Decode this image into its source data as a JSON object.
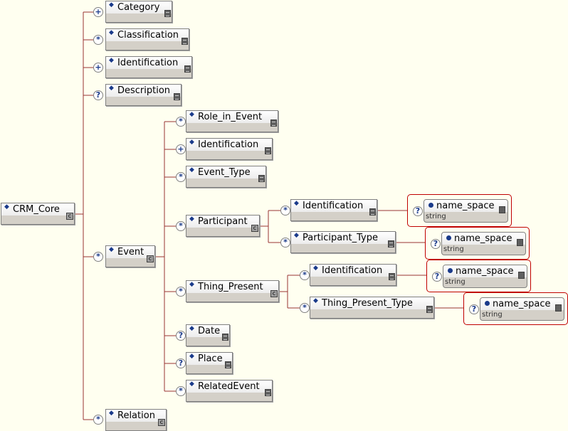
{
  "root": {
    "label": "CRM_Core"
  },
  "children": [
    {
      "label": "Category",
      "cardinality": "+"
    },
    {
      "label": "Classification",
      "cardinality": "*"
    },
    {
      "label": "Identification",
      "cardinality": "+"
    },
    {
      "label": "Description",
      "cardinality": "?"
    },
    {
      "label": "Event",
      "cardinality": "*"
    },
    {
      "label": "Relation",
      "cardinality": "*"
    }
  ],
  "event_children": [
    {
      "label": "Role_in_Event",
      "cardinality": "*"
    },
    {
      "label": "Identification",
      "cardinality": "+"
    },
    {
      "label": "Event_Type",
      "cardinality": "*"
    },
    {
      "label": "Participant",
      "cardinality": "*"
    },
    {
      "label": "Thing_Present",
      "cardinality": "*"
    },
    {
      "label": "Date",
      "cardinality": "?"
    },
    {
      "label": "Place",
      "cardinality": "?"
    },
    {
      "label": "RelatedEvent",
      "cardinality": "*"
    }
  ],
  "participant_children": [
    {
      "label": "Identification",
      "cardinality": "*"
    },
    {
      "label": "Participant_Type",
      "cardinality": "*"
    }
  ],
  "thing_children": [
    {
      "label": "Identification",
      "cardinality": "*"
    },
    {
      "label": "Thing_Present_Type",
      "cardinality": "*"
    }
  ],
  "attribute": {
    "label": "name_space",
    "type": "string",
    "cardinality": "?"
  },
  "compositor_glyph": "c",
  "colors": {
    "background": "#fffff0",
    "connector": "#993333",
    "attr_group_border": "#c00000",
    "diamond": "#1a3a8a"
  }
}
